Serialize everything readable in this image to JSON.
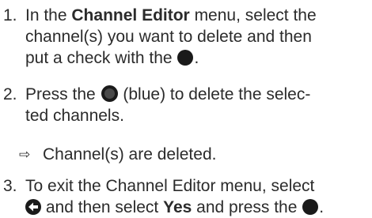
{
  "steps": [
    {
      "number": "1.",
      "l1_pre": "In the ",
      "l1_bold": "Channel Editor",
      "l1_post": " menu, select the",
      "l2": "channel(s) you want to delete and then",
      "l3_pre": "put a check with the ",
      "l3_post": ".",
      "icon": "filled-circle-icon"
    },
    {
      "number": "2.",
      "l1_pre": "Press the ",
      "l1_post": " (blue) to delete the selec-",
      "l2": "ted channels.",
      "icon": "blue-button-icon"
    },
    {
      "number": "3.",
      "l1": "To exit the Channel Editor menu, select",
      "l2_mid1": " and then select ",
      "l2_bold": "Yes",
      "l2_mid2": " and press the ",
      "l2_end": ".",
      "icons": [
        "back-arrow-icon",
        "filled-circle-icon"
      ]
    }
  ],
  "result": {
    "arrow_icon": "right-arrow-outline-icon",
    "text": "Channel(s) are deleted."
  },
  "colors": {
    "text": "#2b2b2b",
    "icon": "#1a1a1a"
  }
}
